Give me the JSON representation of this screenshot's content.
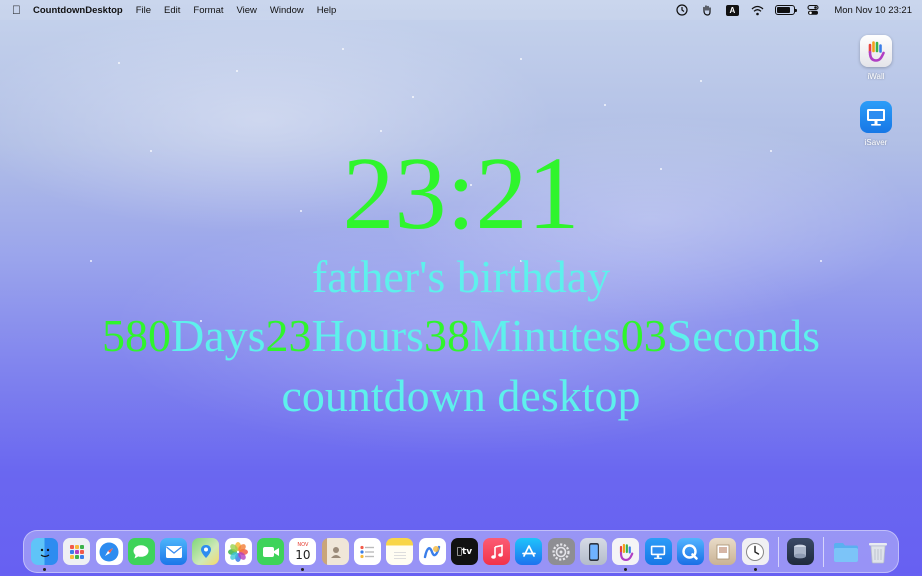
{
  "menubar": {
    "app_name": "CountdownDesktop",
    "menus": [
      "File",
      "Edit",
      "Format",
      "View",
      "Window",
      "Help"
    ],
    "input_source": "A",
    "datetime": "Mon Nov 10  23:21"
  },
  "desktop_icons": [
    {
      "label": "iWall"
    },
    {
      "label": "iSaver"
    }
  ],
  "countdown": {
    "time": "23:21",
    "event": "father's birthday",
    "days": "580",
    "days_unit": "Days",
    "hours": "23",
    "hours_unit": "Hours",
    "minutes": "38",
    "minutes_unit": "Minutes",
    "seconds": "03",
    "seconds_unit": "Seconds",
    "caption": "countdown desktop"
  },
  "dock": {
    "calendar_month": "NOV",
    "calendar_day": "10"
  },
  "colors": {
    "countdown_green": "#2ff52c",
    "countdown_cyan": "#5ef0ec"
  }
}
